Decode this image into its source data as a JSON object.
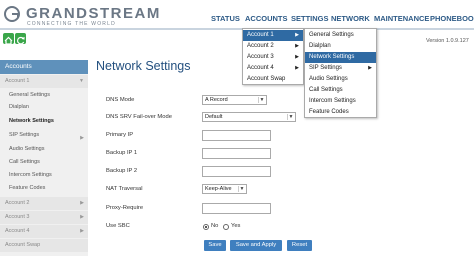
{
  "brand": {
    "name": "GRANDSTREAM",
    "tagline": "CONNECTING THE WORLD"
  },
  "topnav": [
    "STATUS",
    "ACCOUNTS",
    "SETTINGS",
    "NETWORK",
    "MAINTENANCE",
    "PHONEBOOK"
  ],
  "version": "Version 1.0.9.127",
  "sidebar": {
    "header": "Accounts",
    "account1": "Account 1",
    "items": [
      "General Settings",
      "Dialplan",
      "Network Settings",
      "SIP Settings",
      "Audio Settings",
      "Call Settings",
      "Intercom Settings",
      "Feature Codes"
    ],
    "other_accounts": [
      "Account 2",
      "Account 3",
      "Account 4",
      "Account Swap"
    ]
  },
  "page": {
    "title": "Network Settings",
    "fields": [
      {
        "label": "DNS Mode",
        "value": "A Record"
      },
      {
        "label": "DNS SRV Fail-over Mode",
        "value": "Default"
      },
      {
        "label": "Primary IP",
        "value": ""
      },
      {
        "label": "Backup IP 1",
        "value": ""
      },
      {
        "label": "Backup IP 2",
        "value": ""
      },
      {
        "label": "NAT Traversal",
        "value": "Keep-Alive"
      },
      {
        "label": "Proxy-Require",
        "value": ""
      },
      {
        "label": "Use SBC",
        "value": "No"
      }
    ],
    "radio_no": "No",
    "radio_yes": "Yes",
    "buttons": {
      "save": "Save",
      "save_apply": "Save and Apply",
      "reset": "Reset"
    }
  },
  "accounts_menu": [
    "Account 1",
    "Account 2",
    "Account 3",
    "Account 4",
    "Account Swap"
  ],
  "submenu": [
    "General Settings",
    "Dialplan",
    "Network Settings",
    "SIP Settings",
    "Audio Settings",
    "Call Settings",
    "Intercom Settings",
    "Feature Codes"
  ],
  "colors": {
    "accent": "#2f6aa3",
    "button": "#3f7fbf",
    "sidebar_header": "#5f91bb",
    "title": "#24507f"
  }
}
